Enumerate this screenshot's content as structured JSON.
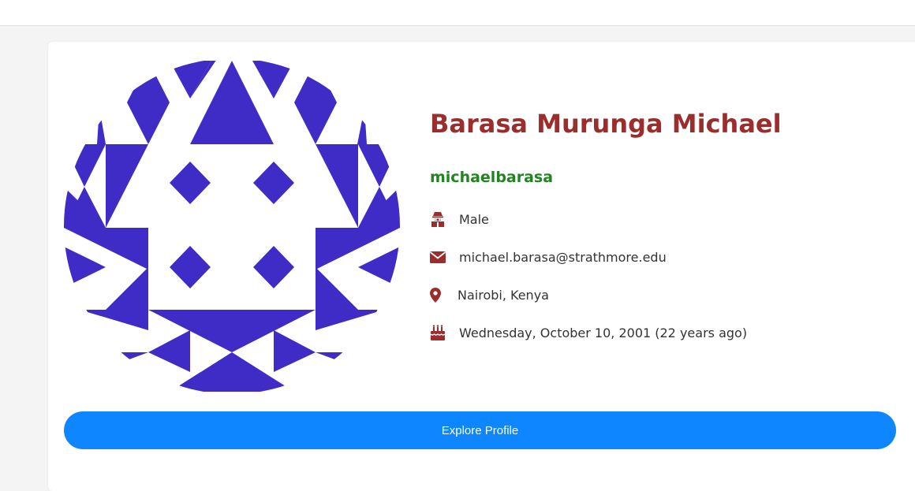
{
  "profile": {
    "full_name": "Barasa Murunga Michael",
    "username": "michaelbarasa",
    "details": [
      {
        "icon": "person-icon",
        "text": "Male"
      },
      {
        "icon": "envelope-icon",
        "text": "michael.barasa@strathmore.edu"
      },
      {
        "icon": "map-marker-icon",
        "text": "Nairobi, Kenya"
      },
      {
        "icon": "birthday-cake-icon",
        "text": "Wednesday, October 10, 2001 (22 years ago)"
      }
    ],
    "avatar_icon": "identicon-avatar"
  },
  "actions": {
    "explore_label": "Explore Profile"
  },
  "colors": {
    "name": "#9b2d2d",
    "username": "#218321",
    "icon": "#9b2d2d",
    "button": "#0d86ff",
    "avatar": "#3f2bc6"
  }
}
